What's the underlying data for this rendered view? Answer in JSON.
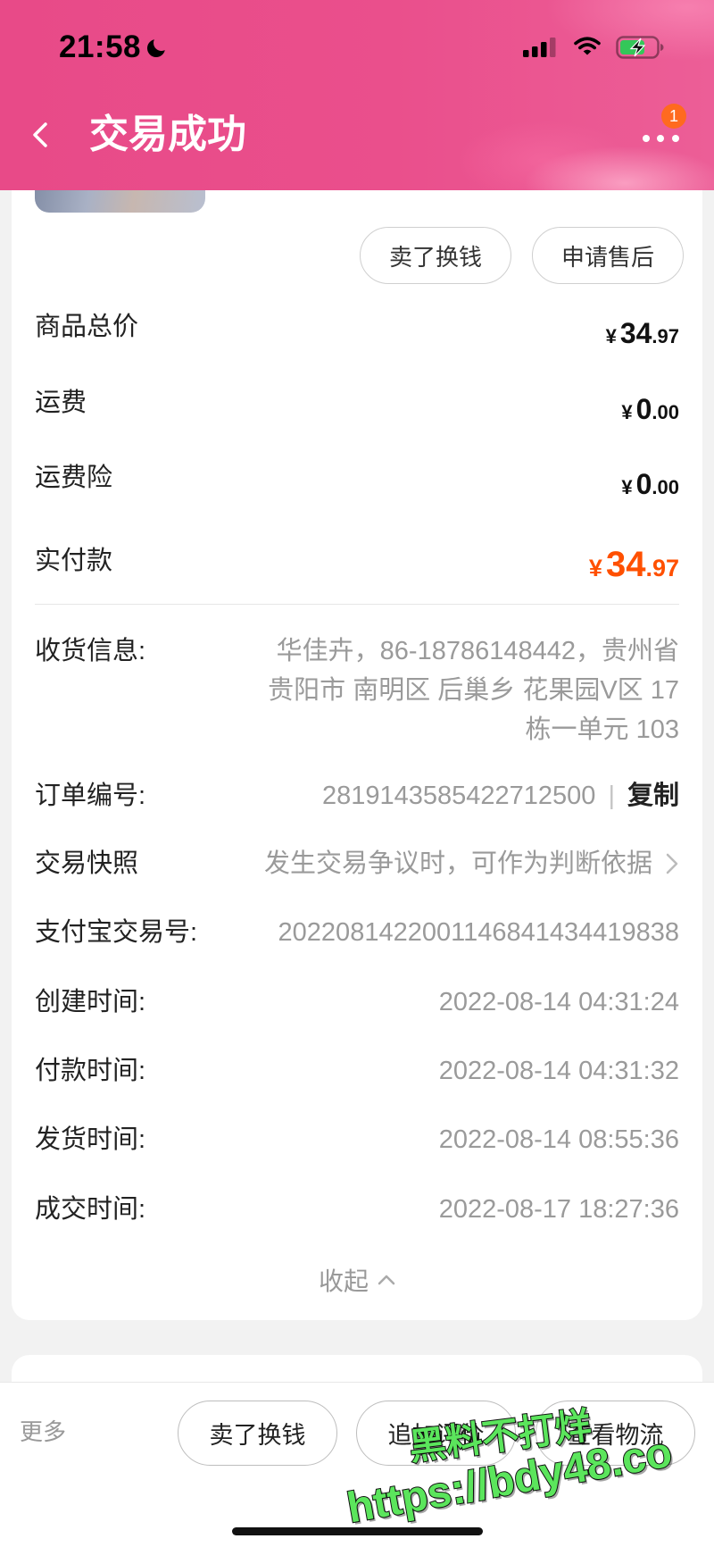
{
  "status_bar": {
    "time": "21:58",
    "icons": [
      "moon-icon",
      "signal-icon",
      "wifi-icon",
      "battery-charging-icon"
    ]
  },
  "header": {
    "title": "交易成功",
    "back_icon": "chevron-left-icon",
    "more_icon": "more-dots-icon",
    "badge_count": "1"
  },
  "theme": {
    "header_pink": "#E84A88",
    "accent_orange": "#FF5000",
    "badge_orange": "#FF6A1F",
    "watermark_green": "#5BE55C"
  },
  "order_card": {
    "actions": {
      "sell": "卖了换钱",
      "after_sale": "申请售后"
    },
    "prices": [
      {
        "label": "商品总价",
        "currency": "¥",
        "integer": "34",
        "decimal": ".97"
      },
      {
        "label": "运费",
        "currency": "¥",
        "integer": "0",
        "decimal": ".00"
      },
      {
        "label": "运费险",
        "currency": "¥",
        "integer": "0",
        "decimal": ".00"
      },
      {
        "label": "实付款",
        "currency": "¥",
        "integer": "34",
        "decimal": ".97"
      }
    ],
    "details": {
      "shipping": {
        "label": "收货信息:",
        "lines": [
          "华佳卉，86-18786148442，贵州省",
          "贵阳市 南明区 后巢乡 花果园V区 17",
          "栋一单元 103"
        ]
      },
      "order_no": {
        "label": "订单编号:",
        "value": "2819143585422712500",
        "separator": "|",
        "copy": "复制"
      },
      "snapshot": {
        "label": "交易快照",
        "value": "发生交易争议时，可作为判断依据",
        "icon": "chevron-right-icon"
      },
      "alipay_no": {
        "label": "支付宝交易号:",
        "value": "2022081422001146841434419838"
      },
      "created": {
        "label": "创建时间:",
        "value": "2022-08-14 04:31:24"
      },
      "paid": {
        "label": "付款时间:",
        "value": "2022-08-14 04:31:32"
      },
      "shipped": {
        "label": "发货时间:",
        "value": "2022-08-14 08:55:36"
      },
      "completed": {
        "label": "成交时间:",
        "value": "2022-08-17 18:27:36"
      }
    },
    "collapse": {
      "label": "收起",
      "icon": "chevron-up-icon"
    }
  },
  "bottom_bar": {
    "more": "更多",
    "buttons": {
      "sell": "卖了换钱",
      "review": "追加评价",
      "logistics": "查看物流"
    }
  },
  "watermark": {
    "line1": "黑料不打烊",
    "line2": "https://bdy48.co"
  }
}
